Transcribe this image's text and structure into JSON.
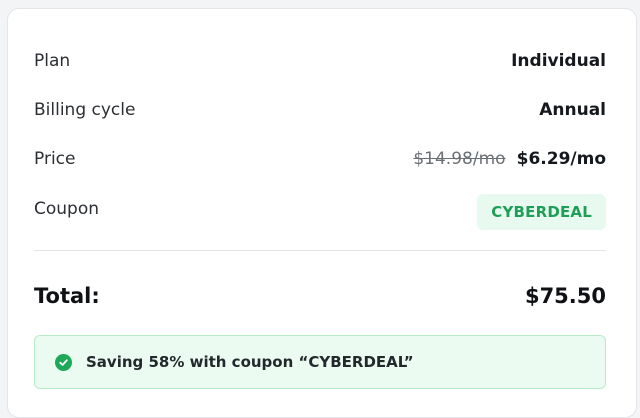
{
  "summary": {
    "plan": {
      "label": "Plan",
      "value": "Individual"
    },
    "billing_cycle": {
      "label": "Billing cycle",
      "value": "Annual"
    },
    "price": {
      "label": "Price",
      "old_value": "$14.98/mo",
      "value": "$6.29/mo"
    },
    "coupon": {
      "label": "Coupon",
      "code": "CYBERDEAL"
    },
    "total": {
      "label": "Total:",
      "value": "$75.50"
    },
    "saving_message": "Saving 58% with coupon “CYBERDEAL”"
  },
  "colors": {
    "accent_green": "#1fa85a",
    "badge_background": "#e8faf0",
    "saving_background": "#ebfbf1"
  },
  "icons": {
    "saving": "check-circle-icon"
  }
}
